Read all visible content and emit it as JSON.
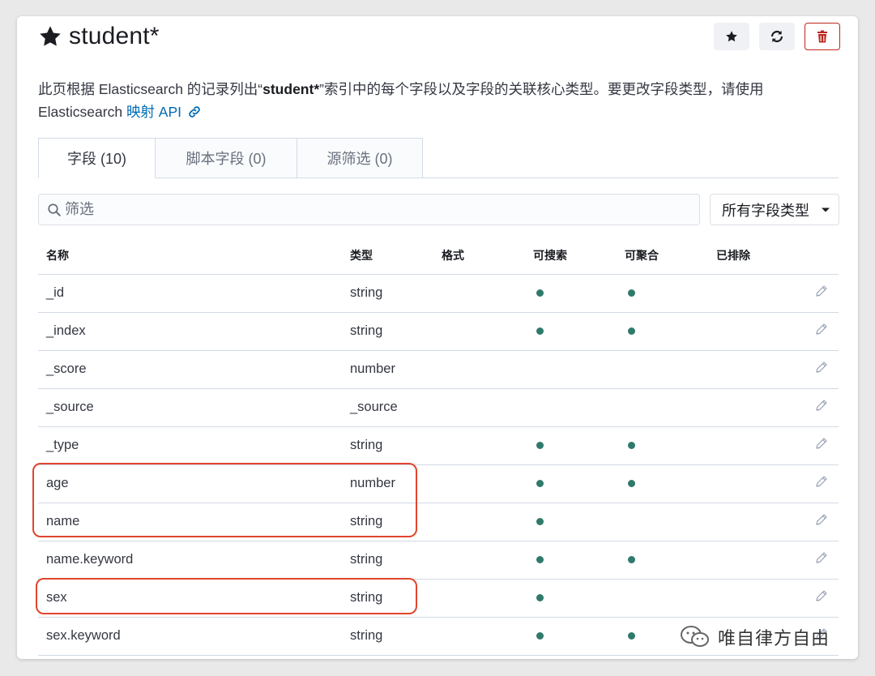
{
  "header": {
    "title": "student*",
    "star_label": "★",
    "refresh_label": "⟳",
    "delete_label": "🗑"
  },
  "description": {
    "part1": "此页根据 Elasticsearch 的记录列出“",
    "pattern": "student*",
    "part2": "”索引中的每个字段以及字段的关联核心类型。要更改字段类型，请使用",
    "part3": "Elasticsearch ",
    "link_text": "映射 API"
  },
  "tabs": [
    {
      "label": "字段 (10)"
    },
    {
      "label": "脚本字段 (0)"
    },
    {
      "label": "源筛选 (0)"
    }
  ],
  "filter": {
    "placeholder": "筛选",
    "value": ""
  },
  "type_select": {
    "label": "所有字段类型"
  },
  "table": {
    "headers": [
      "名称",
      "类型",
      "格式",
      "可搜索",
      "可聚合",
      "已排除"
    ],
    "rows": [
      {
        "name": "_id",
        "type": "string",
        "format": "",
        "searchable": true,
        "aggregatable": true,
        "excluded": false
      },
      {
        "name": "_index",
        "type": "string",
        "format": "",
        "searchable": true,
        "aggregatable": true,
        "excluded": false
      },
      {
        "name": "_score",
        "type": "number",
        "format": "",
        "searchable": false,
        "aggregatable": false,
        "excluded": false
      },
      {
        "name": "_source",
        "type": "_source",
        "format": "",
        "searchable": false,
        "aggregatable": false,
        "excluded": false
      },
      {
        "name": "_type",
        "type": "string",
        "format": "",
        "searchable": true,
        "aggregatable": true,
        "excluded": false
      },
      {
        "name": "age",
        "type": "number",
        "format": "",
        "searchable": true,
        "aggregatable": true,
        "excluded": false
      },
      {
        "name": "name",
        "type": "string",
        "format": "",
        "searchable": true,
        "aggregatable": false,
        "excluded": false
      },
      {
        "name": "name.keyword",
        "type": "string",
        "format": "",
        "searchable": true,
        "aggregatable": true,
        "excluded": false
      },
      {
        "name": "sex",
        "type": "string",
        "format": "",
        "searchable": true,
        "aggregatable": false,
        "excluded": false
      },
      {
        "name": "sex.keyword",
        "type": "string",
        "format": "",
        "searchable": true,
        "aggregatable": true,
        "excluded": false
      }
    ]
  },
  "watermark": {
    "text": "唯自律方自由"
  },
  "colors": {
    "dot": "#2f7a6b",
    "link": "#006bb4",
    "danger": "#bd271e",
    "highlight": "#e0452d",
    "pencil": "#98a2b3"
  }
}
